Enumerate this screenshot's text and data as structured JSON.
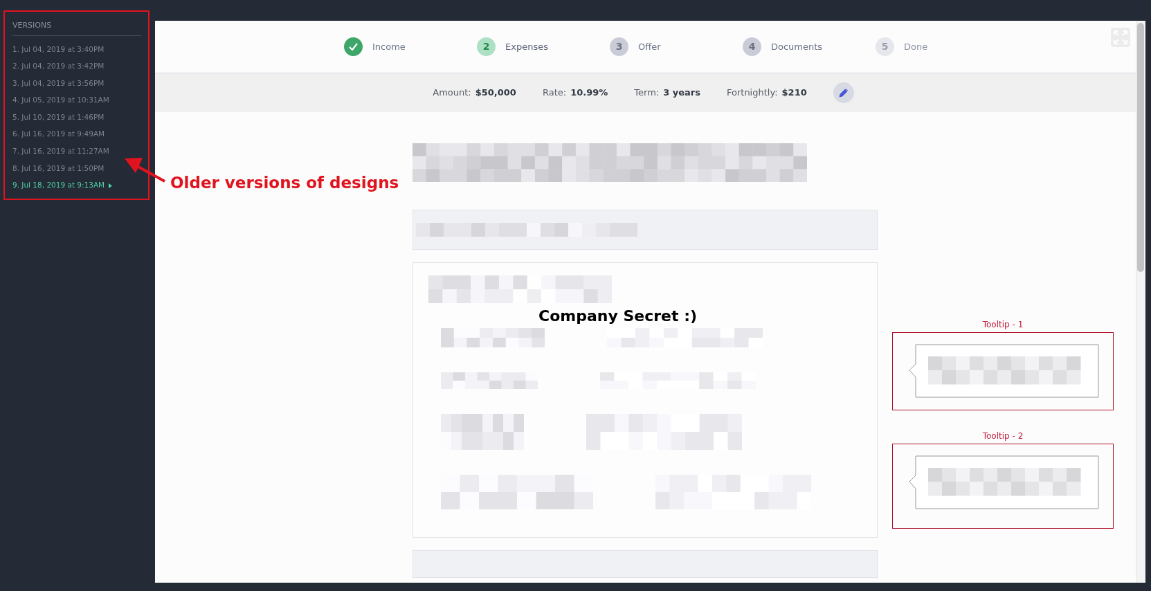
{
  "versions": {
    "title": "VERSIONS",
    "items": [
      {
        "label": "1. Jul 04, 2019 at 3:40PM",
        "selected": false
      },
      {
        "label": "2. Jul 04, 2019 at 3:42PM",
        "selected": false
      },
      {
        "label": "3. Jul 04, 2019 at 3:56PM",
        "selected": false
      },
      {
        "label": "4. Jul 05, 2019 at 10:31AM",
        "selected": false
      },
      {
        "label": "5. Jul 10, 2019 at 1:46PM",
        "selected": false
      },
      {
        "label": "6. Jul 16, 2019 at 9:49AM",
        "selected": false
      },
      {
        "label": "7. Jul 16, 2019 at 11:27AM",
        "selected": false
      },
      {
        "label": "8. Jul 16, 2019 at 1:50PM",
        "selected": false
      },
      {
        "label": "9. Jul 18, 2019 at 9:13AM",
        "selected": true
      }
    ]
  },
  "annotations": [
    {
      "kind": "arrow",
      "text": "Older versions of designs"
    },
    {
      "kind": "plain",
      "text": "Company Secret :)"
    }
  ],
  "steps": [
    {
      "label": "Income",
      "completed": true,
      "selected": false,
      "disabled": false
    },
    {
      "number": "2",
      "label": "Expenses",
      "completed": false,
      "selected": true,
      "disabled": false
    },
    {
      "number": "3",
      "label": "Offer",
      "completed": false,
      "selected": false,
      "disabled": false
    },
    {
      "number": "4",
      "label": "Documents",
      "completed": false,
      "selected": false,
      "disabled": false
    },
    {
      "number": "5",
      "label": "Done",
      "completed": false,
      "selected": false,
      "disabled": true
    }
  ],
  "summary": [
    {
      "label": "Amount:",
      "value": "$50,000"
    },
    {
      "label": "Rate:",
      "value": "10.99%"
    },
    {
      "label": "Term:",
      "value": "3 years"
    },
    {
      "label": "Fortnightly:",
      "value": "$210"
    }
  ],
  "tooltips": [
    {
      "title": "Tooltip - 1"
    },
    {
      "title": "Tooltip - 2"
    }
  ]
}
